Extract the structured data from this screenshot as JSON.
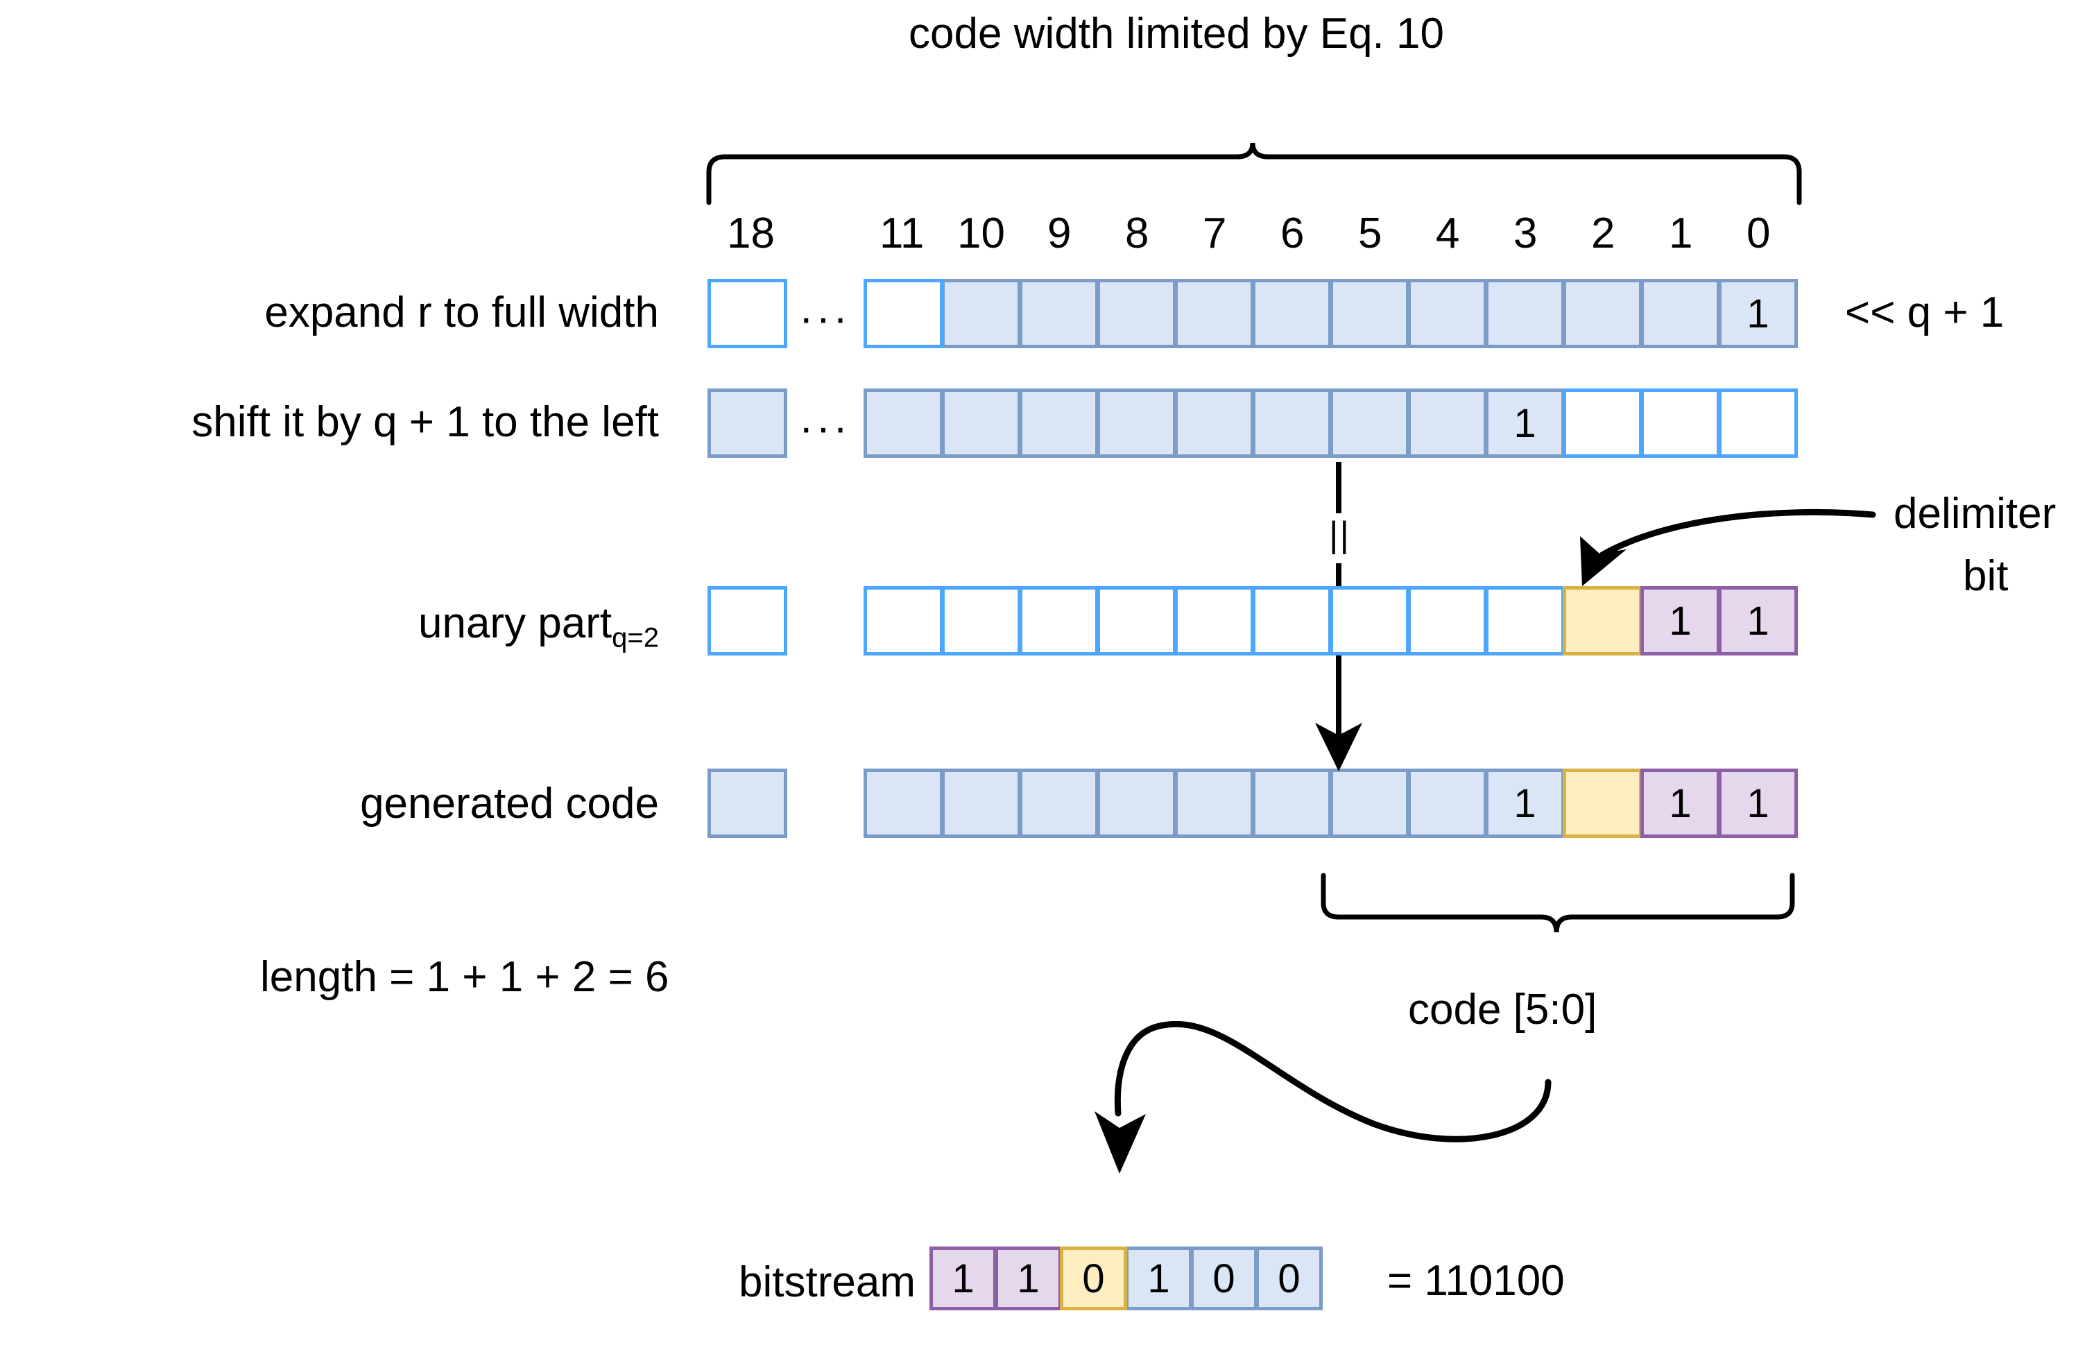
{
  "diagram": {
    "title": "code width limited by Eq. 10",
    "bit_indices": [
      "18",
      "11",
      "10",
      "9",
      "8",
      "7",
      "6",
      "5",
      "4",
      "3",
      "2",
      "1",
      "0"
    ],
    "ellipsis": "···",
    "concat_symbol": "||",
    "colors": {
      "blue_fill": "#dae6f5",
      "blue_border": "#7a9cc6",
      "empty_border": "#4da6ff",
      "yellow_fill": "#fdeec2",
      "yellow_border": "#d9b243",
      "purple_fill": "#e5d7ec",
      "purple_border": "#8f5fa6",
      "line": "#000000"
    },
    "rows": [
      {
        "label": "expand r to full width",
        "side_note": "<< q + 1",
        "msb_cell": {
          "style": "empty",
          "value": ""
        },
        "cells": [
          {
            "style": "empty",
            "value": ""
          },
          {
            "style": "blue",
            "value": ""
          },
          {
            "style": "blue",
            "value": ""
          },
          {
            "style": "blue",
            "value": ""
          },
          {
            "style": "blue",
            "value": ""
          },
          {
            "style": "blue",
            "value": ""
          },
          {
            "style": "blue",
            "value": ""
          },
          {
            "style": "blue",
            "value": ""
          },
          {
            "style": "blue",
            "value": ""
          },
          {
            "style": "blue",
            "value": ""
          },
          {
            "style": "blue",
            "value": ""
          },
          {
            "style": "blue",
            "value": "1"
          }
        ]
      },
      {
        "label": "shift it by q + 1 to the left",
        "side_note": "",
        "msb_cell": {
          "style": "blue",
          "value": ""
        },
        "cells": [
          {
            "style": "blue",
            "value": ""
          },
          {
            "style": "blue",
            "value": ""
          },
          {
            "style": "blue",
            "value": ""
          },
          {
            "style": "blue",
            "value": ""
          },
          {
            "style": "blue",
            "value": ""
          },
          {
            "style": "blue",
            "value": ""
          },
          {
            "style": "blue",
            "value": ""
          },
          {
            "style": "blue",
            "value": ""
          },
          {
            "style": "blue",
            "value": "1"
          },
          {
            "style": "empty",
            "value": ""
          },
          {
            "style": "empty",
            "value": ""
          },
          {
            "style": "empty",
            "value": ""
          }
        ]
      },
      {
        "label": "unary part",
        "label_sub": "q=2",
        "side_note": "",
        "msb_cell": {
          "style": "empty",
          "value": ""
        },
        "cells": [
          {
            "style": "empty",
            "value": ""
          },
          {
            "style": "empty",
            "value": ""
          },
          {
            "style": "empty",
            "value": ""
          },
          {
            "style": "empty",
            "value": ""
          },
          {
            "style": "empty",
            "value": ""
          },
          {
            "style": "empty",
            "value": ""
          },
          {
            "style": "empty",
            "value": ""
          },
          {
            "style": "empty",
            "value": ""
          },
          {
            "style": "empty",
            "value": ""
          },
          {
            "style": "yellow",
            "value": ""
          },
          {
            "style": "purple",
            "value": "1"
          },
          {
            "style": "purple",
            "value": "1"
          }
        ]
      },
      {
        "label": "generated code",
        "side_note": "",
        "msb_cell": {
          "style": "blue",
          "value": ""
        },
        "cells": [
          {
            "style": "blue",
            "value": ""
          },
          {
            "style": "blue",
            "value": ""
          },
          {
            "style": "blue",
            "value": ""
          },
          {
            "style": "blue",
            "value": ""
          },
          {
            "style": "blue",
            "value": ""
          },
          {
            "style": "blue",
            "value": ""
          },
          {
            "style": "blue",
            "value": ""
          },
          {
            "style": "blue",
            "value": ""
          },
          {
            "style": "blue",
            "value": "1"
          },
          {
            "style": "yellow",
            "value": ""
          },
          {
            "style": "purple",
            "value": "1"
          },
          {
            "style": "purple",
            "value": "1"
          }
        ]
      }
    ],
    "annotations": {
      "delimiter_label_line1": "delimiter",
      "delimiter_label_line2": "bit",
      "length_equation": "length = 1 + 1 + 2 = 6",
      "code_slice_label": "code [5:0]"
    },
    "bitstream": {
      "label": "bitstream",
      "cells": [
        {
          "style": "purple",
          "value": "1"
        },
        {
          "style": "purple",
          "value": "1"
        },
        {
          "style": "yellow",
          "value": "0"
        },
        {
          "style": "blue",
          "value": "1"
        },
        {
          "style": "blue",
          "value": "0"
        },
        {
          "style": "blue",
          "value": "0"
        }
      ],
      "result": "= 110100"
    }
  }
}
